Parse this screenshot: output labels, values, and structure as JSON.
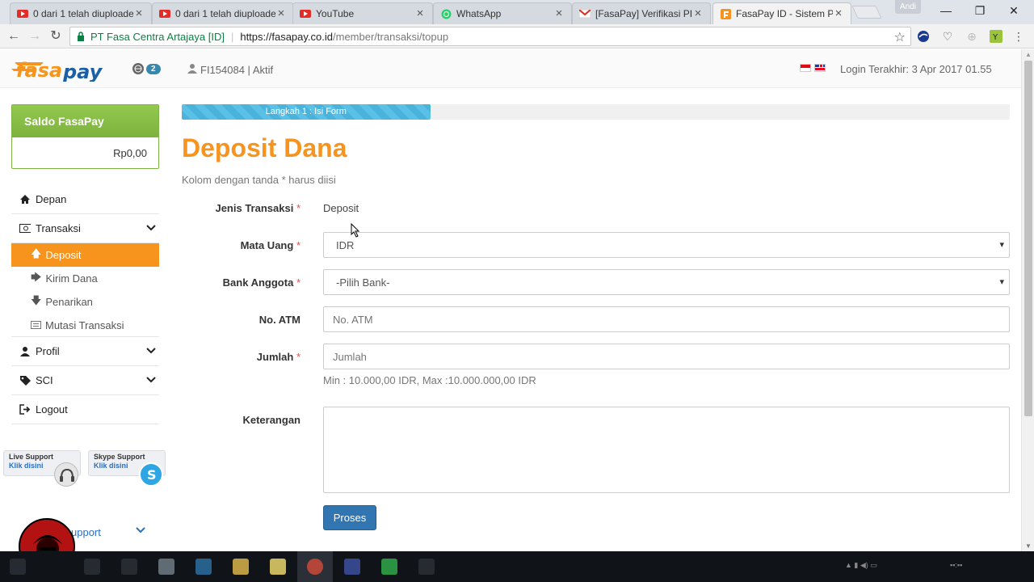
{
  "browser": {
    "tabs": [
      {
        "title": "0 dari 1 telah diuploade",
        "icon": "youtube-icon"
      },
      {
        "title": "0 dari 1 telah diuploade",
        "icon": "youtube-icon"
      },
      {
        "title": "YouTube",
        "icon": "youtube-icon"
      },
      {
        "title": "WhatsApp",
        "icon": "whatsapp-icon"
      },
      {
        "title": "[FasaPay] Verifikasi PIN",
        "icon": "gmail-icon"
      },
      {
        "title": "FasaPay ID - Sistem Pe",
        "icon": "fasapay-icon"
      }
    ],
    "profile_name": "Andi",
    "address": {
      "org": "PT Fasa Centra Artajaya [ID]",
      "host": "https://fasapay.co.id",
      "path": "/member/transaksi/topup"
    }
  },
  "header": {
    "logo_text": "FasaPay",
    "notif_count": "2",
    "account": "FI154084 | Aktif",
    "last_login": "Login Terakhir: 3 Apr 2017 01.55"
  },
  "sidebar": {
    "saldo_title": "Saldo FasaPay",
    "saldo_amount": "Rp0,00",
    "items": {
      "depan": "Depan",
      "transaksi": "Transaksi",
      "deposit": "Deposit",
      "kirim": "Kirim Dana",
      "penarikan": "Penarikan",
      "mutasi": "Mutasi Transaksi",
      "profil": "Profil",
      "sci": "SCI",
      "logout": "Logout"
    },
    "live_support": {
      "title": "Live Support",
      "link": "Klik disini"
    },
    "skype_support": {
      "title": "Skype Support",
      "link": "Klik disini"
    },
    "support_link": "upport"
  },
  "main": {
    "step_label": "Langkah 1 : Isi Form",
    "step_progress": 0.3,
    "title": "Deposit Dana",
    "hint": "Kolom dengan tanda * harus diisi",
    "required_mark": "*",
    "jenis": {
      "label": "Jenis Transaksi",
      "value": "Deposit"
    },
    "mata_uang": {
      "label": "Mata Uang",
      "value": "IDR"
    },
    "bank": {
      "label": "Bank Anggota",
      "value": "-Pilih Bank-"
    },
    "atm": {
      "label": "No. ATM",
      "placeholder": "No. ATM"
    },
    "jumlah": {
      "label": "Jumlah",
      "placeholder": "Jumlah"
    },
    "minmax": "Min : 10.000,00 IDR, Max :10.000.000,00 IDR",
    "keterangan": {
      "label": "Keterangan"
    },
    "submit": "Proses"
  },
  "colors": {
    "accent_orange": "#f7941d",
    "saldo_green": "#8bc34a",
    "button_blue": "#3276b1",
    "progress_blue": "#4ab3dc"
  }
}
